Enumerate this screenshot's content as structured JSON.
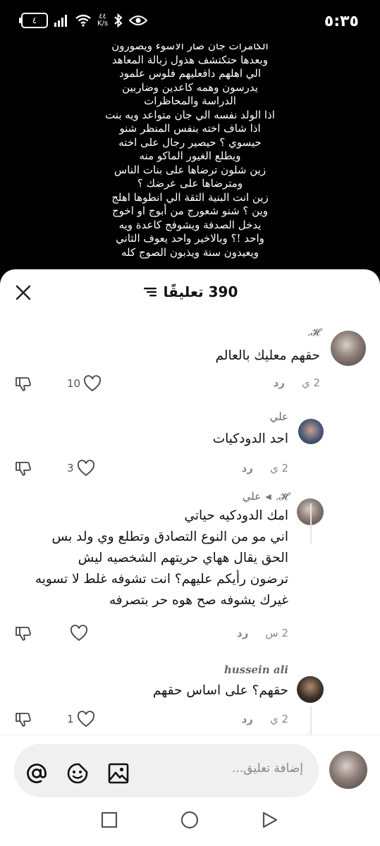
{
  "status": {
    "time": "٥:٣٥",
    "battery": "٤",
    "net_speed": [
      "٤٤",
      "K/s"
    ]
  },
  "story": {
    "lines": [
      "الكامرات جان صار الاسوء ويصورون",
      "وبعدها حتكتشف هذول زبالة المعاهد",
      "الي اهلهم دافعليهم فلوس علمود",
      "يدرسون وهمه كاعدين وضاربين",
      "الدراسة والمحاظرات",
      "اذا الولد نفسه الي جان متواعد ويه بنت",
      "اذا شاف اخته بنفس المنظر شنو",
      "حيسوي ؟ حيصير رجال على اخته",
      "ويطلع الغيور الماكو منه",
      "زين شلون ترضاها على بنات الناس",
      "ومترضاها على عرضك ؟",
      "زين انت البنية الثقة الي انطوها اهلج",
      "وين ؟ شنو شعورج من أبوج او اخوج",
      "يدخل الصدفة ويشوفج كاعدة ويه",
      "واحد !؟ وبالاخير واحد يعوف الثاني",
      "ويعيدون سنة ويذبون الصوج كله"
    ]
  },
  "sheet": {
    "title": "390 تعليقًا"
  },
  "comments": [
    {
      "name": "𝓗.",
      "text": [
        "حقهم معليك بالعالم"
      ],
      "time": "2 ي",
      "reply": "رد",
      "likes": "10"
    },
    {
      "name": "علي",
      "text": [
        "احد الدودكيات"
      ],
      "time": "2 ي",
      "reply": "رد",
      "likes": "3"
    },
    {
      "name": "𝓗.",
      "reply_to": "علي",
      "text": [
        "امك الدودكيه حياتي",
        "اني مو من النوع التصادق وتطلع وي ولد بس",
        "الحق يقال ههاي حريتهم الشخصيه ليش",
        "ترضون رأيكم عليهم؟ انت تشوفه غلط لا تسويه",
        "غيرك يشوفه صح هوه حر بتصرفه"
      ],
      "time": "2 س",
      "reply": "رد",
      "likes": ""
    },
    {
      "name": "hussein ali",
      "text": [
        "حقهم؟ على اساس حقهم"
      ],
      "time": "2 ي",
      "reply": "رد",
      "likes": "1"
    }
  ],
  "composer": {
    "placeholder": "إضافة تعليق..."
  },
  "colors": {
    "sheet_bg": "#ffffff",
    "input_bg": "#f0f0f0",
    "text": "#111111",
    "muted": "#888888"
  }
}
